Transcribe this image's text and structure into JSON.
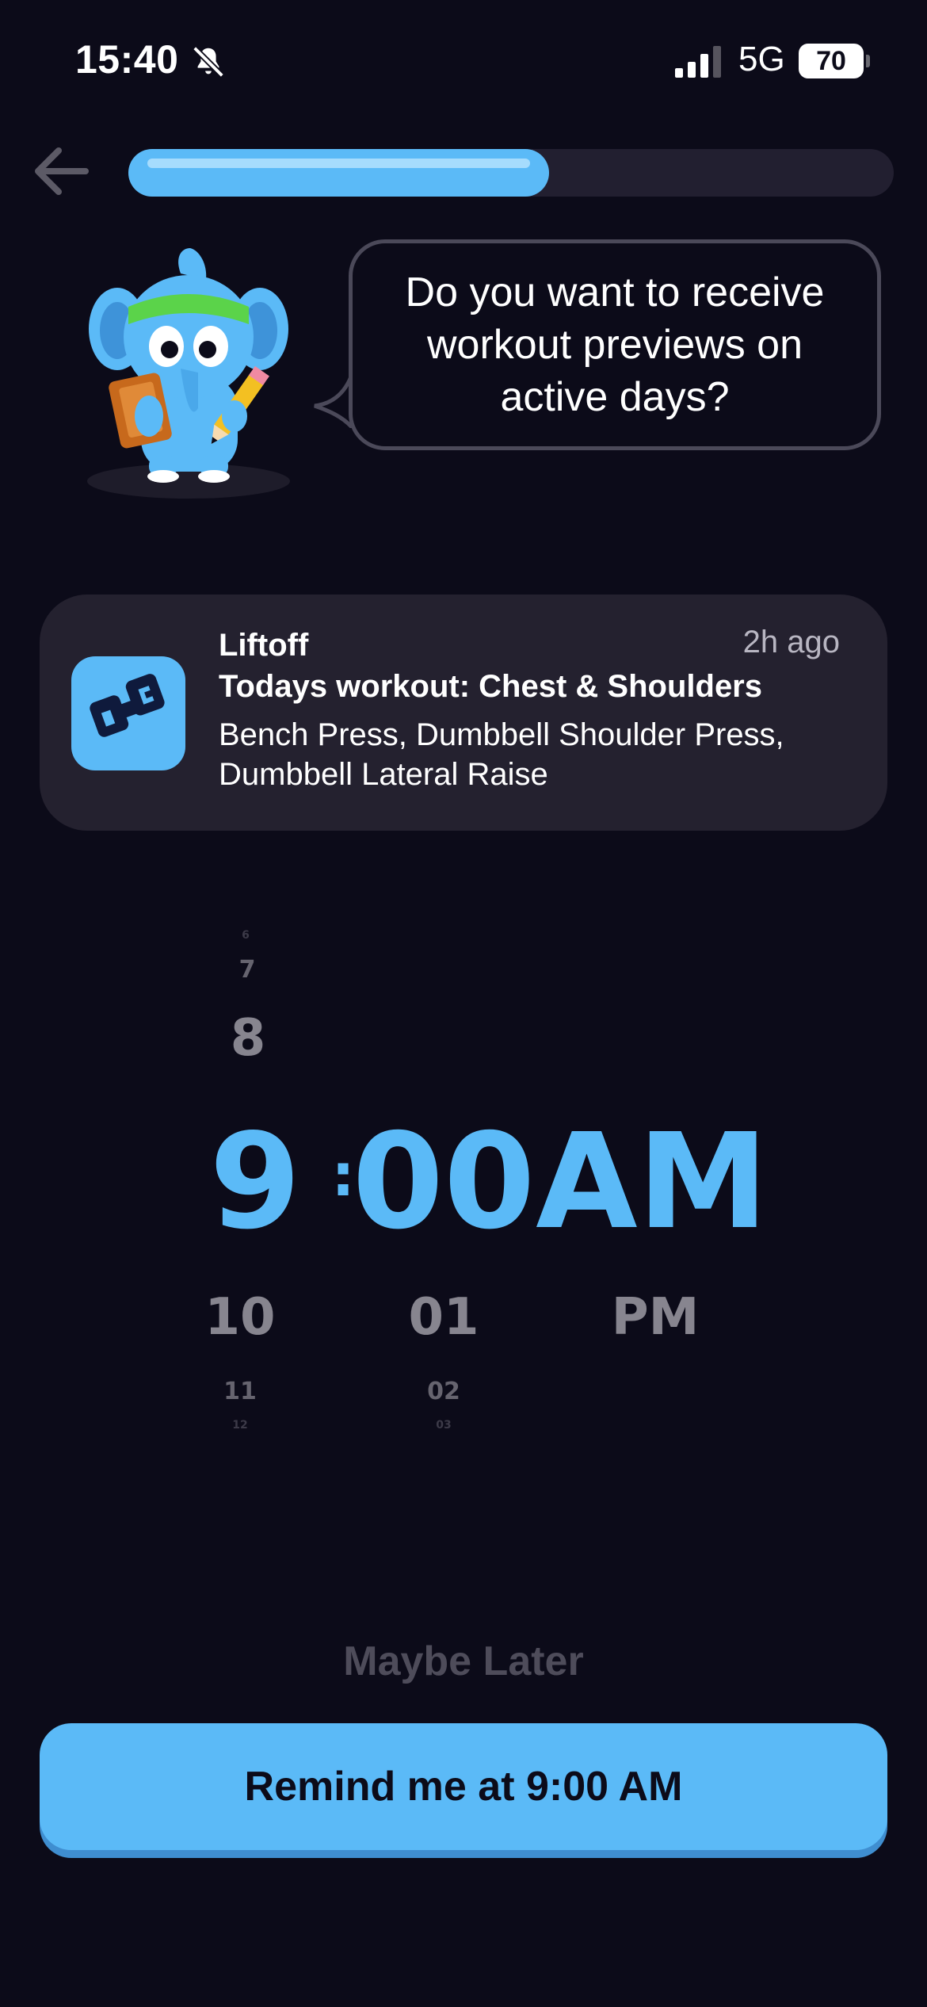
{
  "status_bar": {
    "time": "15:40",
    "network": "5G",
    "battery": "70",
    "icons": [
      "bell-slash-icon",
      "signal-icon"
    ]
  },
  "header": {
    "back_icon": "arrow-left-icon",
    "progress_fraction": 0.55
  },
  "prompt": {
    "question": "Do you want to receive workout previews on active days?",
    "mascot": "elephant-mascot-with-clipboard"
  },
  "notification_preview": {
    "app_name": "Liftoff",
    "time_ago": "2h ago",
    "title": "Todays workout: Chest & Shoulders",
    "body": "Bench Press, Dumbbell Shoulder Press, Dumbbell Lateral Raise",
    "icon": "liftoff-app-icon"
  },
  "time_picker": {
    "hours_above": [
      "6",
      "7",
      "8"
    ],
    "hour": "9",
    "separator": ":",
    "minute": "00",
    "period": "AM",
    "hours_below": [
      "10",
      "11",
      "12"
    ],
    "minutes_below": [
      "01",
      "02",
      "03"
    ],
    "period_below": "PM"
  },
  "actions": {
    "maybe_later": "Maybe Later",
    "remind": "Remind me at 9:00 AM"
  },
  "colors": {
    "background": "#0c0b19",
    "accent": "#5bbaf7",
    "card": "#24212f"
  }
}
